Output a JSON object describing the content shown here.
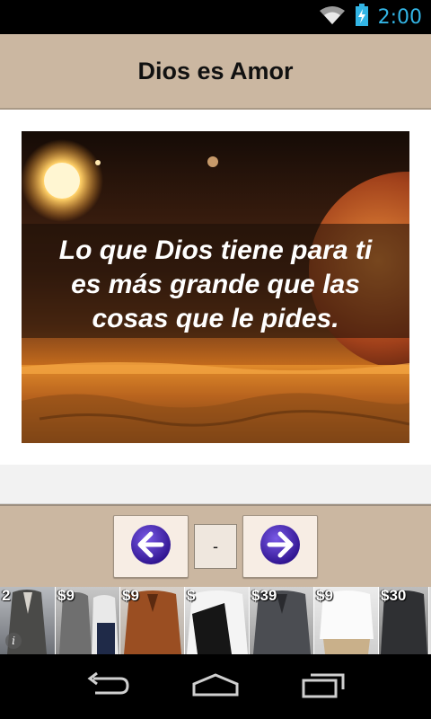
{
  "status_bar": {
    "time": "2:00",
    "accent_color": "#33b5e5"
  },
  "header": {
    "title": "Dios es Amor",
    "background_color": "#cbb7a1"
  },
  "content_image": {
    "quote_lines": [
      "Lo que Dios tiene para ti",
      "es más grande que las",
      "cosas que le pides."
    ]
  },
  "navigation": {
    "prev_icon": "arrow-left-icon",
    "next_icon": "arrow-right-icon",
    "page_indicator": "-"
  },
  "ads": {
    "first_tile_fragment": "2",
    "tiles": [
      {
        "price": "$9"
      },
      {
        "price": "$9"
      },
      {
        "price": "$"
      },
      {
        "price": "$39"
      },
      {
        "price": "$9"
      },
      {
        "price": "$30"
      }
    ]
  },
  "system_nav": {
    "back_icon": "back-icon",
    "home_icon": "home-icon",
    "recents_icon": "recents-icon"
  }
}
